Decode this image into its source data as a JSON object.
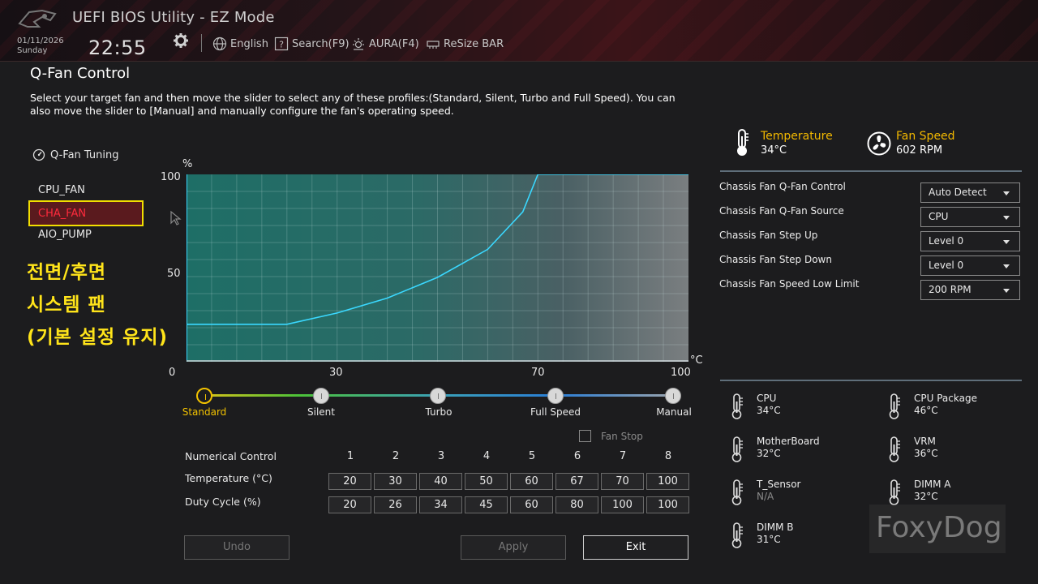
{
  "header": {
    "title": "UEFI BIOS Utility - EZ Mode",
    "date": "01/11/2026",
    "day": "Sunday",
    "time": "22:55",
    "language": "English",
    "search": "Search(F9)",
    "aura": "AURA(F4)",
    "resize_bar": "ReSize BAR"
  },
  "page": {
    "title": "Q-Fan Control",
    "description": "Select your target fan and then move the slider to select any of these profiles:(Standard, Silent, Turbo and Full Speed). You can also move the slider to [Manual] and manually configure the fan's operating speed."
  },
  "left": {
    "tuning_label": "Q-Fan Tuning",
    "fans": [
      "CPU_FAN",
      "CHA_FAN",
      "AIO_PUMP"
    ],
    "selected_fan": "CHA_FAN",
    "annotation": [
      "전면/후면",
      "시스템 팬",
      "(기본 설정 유지)"
    ]
  },
  "chart_data": {
    "type": "line",
    "ylabel": "%",
    "xlabel": "°C",
    "xlim": [
      0,
      100
    ],
    "ylim": [
      0,
      100
    ],
    "x_ticks": [
      "30",
      "70",
      "100"
    ],
    "y_ticks": [
      "100",
      "50",
      "0"
    ],
    "series": [
      {
        "x": [
          0,
          20,
          30,
          40,
          50,
          60,
          67,
          70,
          100
        ],
        "y": [
          20,
          20,
          26,
          34,
          45,
          60,
          80,
          100,
          100
        ],
        "color": "#3ad8ff"
      }
    ],
    "grid": true
  },
  "slider": {
    "options": [
      "Standard",
      "Silent",
      "Turbo",
      "Full Speed",
      "Manual"
    ],
    "selected": "Standard"
  },
  "fan_stop": {
    "label": "Fan Stop",
    "checked": false
  },
  "numerical": {
    "label": "Numerical Control",
    "columns": [
      "1",
      "2",
      "3",
      "4",
      "5",
      "6",
      "7",
      "8"
    ],
    "temp_label": "Temperature (°C)",
    "temperature": [
      "20",
      "30",
      "40",
      "50",
      "60",
      "67",
      "70",
      "100"
    ],
    "duty_label": "Duty Cycle (%)",
    "duty": [
      "20",
      "26",
      "34",
      "45",
      "60",
      "80",
      "100",
      "100"
    ]
  },
  "buttons": {
    "undo": "Undo",
    "apply": "Apply",
    "exit": "Exit"
  },
  "status": {
    "temp_title": "Temperature",
    "temp_value": "34°C",
    "fan_title": "Fan Speed",
    "fan_value": "602 RPM"
  },
  "settings": [
    {
      "label": "Chassis Fan Q-Fan Control",
      "value": "Auto Detect"
    },
    {
      "label": "Chassis Fan Q-Fan Source",
      "value": "CPU"
    },
    {
      "label": "Chassis Fan Step Up",
      "value": "Level 0"
    },
    {
      "label": "Chassis Fan Step Down",
      "value": "Level 0"
    },
    {
      "label": "Chassis Fan Speed Low Limit",
      "value": "200 RPM"
    }
  ],
  "sensors": [
    {
      "name": "CPU",
      "value": "34°C"
    },
    {
      "name": "CPU Package",
      "value": "46°C"
    },
    {
      "name": "MotherBoard",
      "value": "32°C"
    },
    {
      "name": "VRM",
      "value": "36°C"
    },
    {
      "name": "T_Sensor",
      "value": "N/A"
    },
    {
      "name": "DIMM A",
      "value": "32°C"
    },
    {
      "name": "DIMM B",
      "value": "31°C"
    }
  ],
  "watermark": "FoxyDog",
  "colors": {
    "accent": "#f2b800",
    "selected_fan_text": "#ff2a3c",
    "highlight_box": "#f2de00",
    "curve": "#3ad8ff",
    "annotation": "#ffe41a"
  }
}
